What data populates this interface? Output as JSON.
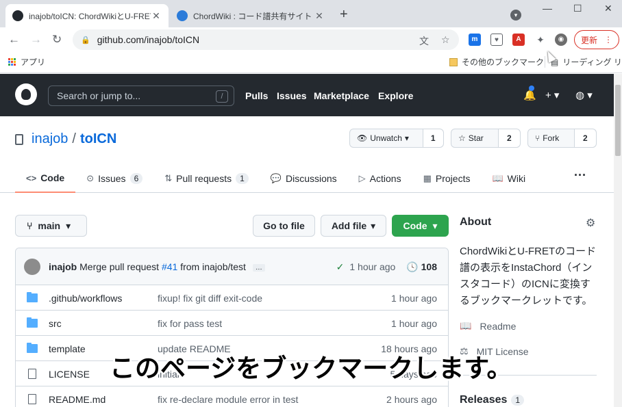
{
  "browser": {
    "tabs": [
      {
        "title": "inajob/toICN: ChordWikiとU-FRET",
        "active": true
      },
      {
        "title": "ChordWiki : コード譜共有サイト 〜表",
        "active": false
      }
    ],
    "new_tab": "+",
    "address": "github.com/inajob/toICN",
    "update_label": "更新",
    "bookmarks": {
      "apps": "アプリ",
      "other": "その他のブックマーク",
      "reading_list": "リーディング リスト"
    }
  },
  "github": {
    "search_placeholder": "Search or jump to...",
    "search_key": "/",
    "nav": [
      "Pulls",
      "Issues",
      "Marketplace",
      "Explore"
    ]
  },
  "repo": {
    "owner": "inajob",
    "separator": "/",
    "name": "toICN",
    "unwatch": {
      "label": "Unwatch",
      "count": "1"
    },
    "star": {
      "label": "Star",
      "count": "2"
    },
    "fork": {
      "label": "Fork",
      "count": "2"
    },
    "tabs": [
      {
        "label": "Code",
        "icon": "<>"
      },
      {
        "label": "Issues",
        "count": "6"
      },
      {
        "label": "Pull requests",
        "count": "1"
      },
      {
        "label": "Discussions"
      },
      {
        "label": "Actions"
      },
      {
        "label": "Projects"
      },
      {
        "label": "Wiki"
      }
    ],
    "branch": "main",
    "go_to_file": "Go to file",
    "add_file": "Add file",
    "code_button": "Code",
    "commit": {
      "author": "inajob",
      "message_pre": "Merge pull request",
      "pr_link": "#41",
      "message_post": "from inajob/test",
      "ellipsis": "…",
      "time": "1 hour ago",
      "commits": "108"
    },
    "files": [
      {
        "type": "folder",
        "name": ".github/workflows",
        "message": "fixup! fix git diff exit-code",
        "time": "1 hour ago"
      },
      {
        "type": "folder",
        "name": "src",
        "message": "fix for pass test",
        "time": "1 hour ago"
      },
      {
        "type": "folder",
        "name": "template",
        "message": "update README",
        "time": "18 hours ago"
      },
      {
        "type": "file",
        "name": "LICENSE",
        "message": "initial",
        "time": "5 days ago"
      },
      {
        "type": "file",
        "name": "README.md",
        "message": "fix re-declare module error in test",
        "time": "2 hours ago"
      }
    ]
  },
  "about": {
    "title": "About",
    "description": "ChordWikiとU-FRETのコード譜の表示をInstaChord（インスタコード）のICNに変換するブックマークレットです。",
    "readme": "Readme",
    "license": "MIT License",
    "releases": "Releases",
    "releases_count": "1"
  },
  "overlay_caption": "このページをブックマークします。",
  "colors": {
    "github_header": "#24292f",
    "link": "#0969da",
    "code_button": "#2da44e",
    "selected_tab_underline": "#fd8c73",
    "folder": "#54aeff",
    "update_button": "#d93025"
  }
}
